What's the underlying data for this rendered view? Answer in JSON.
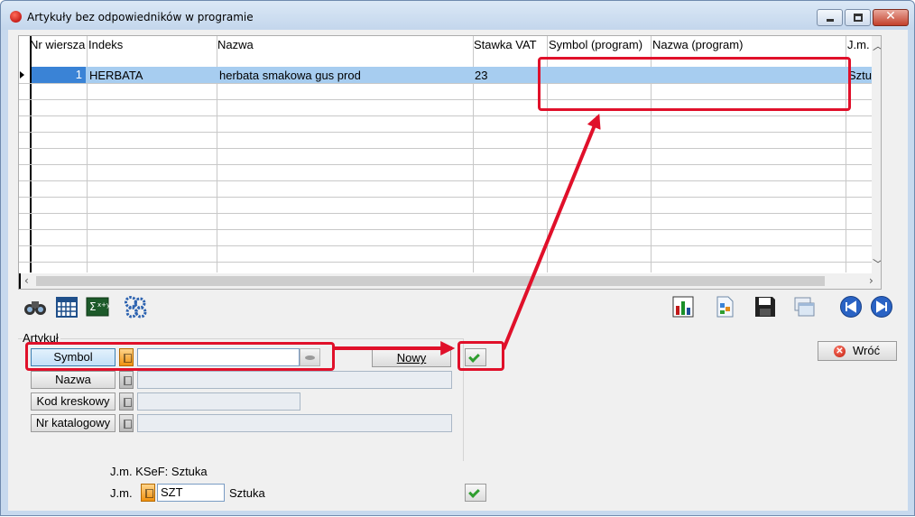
{
  "window": {
    "title": "Artykuły bez odpowiedników w programie"
  },
  "grid": {
    "columns": [
      "Nr wiersza",
      "Indeks",
      "Nazwa",
      "Stawka VAT",
      "Symbol (program)",
      "Nazwa (program)",
      "J.m."
    ],
    "rows": [
      {
        "nr_wiersza": "1",
        "indeks": "HERBATA",
        "nazwa": "herbata smakowa gus prod",
        "stawka_vat": "23",
        "symbol_program": "",
        "nazwa_program": "",
        "jm": "Sztuka"
      }
    ]
  },
  "toolbar": {
    "left_icons": [
      "binoculars-icon",
      "calendar-icon",
      "formula-icon",
      "gears-icon"
    ],
    "right_icons": [
      "chart-icon",
      "document-icon",
      "save-icon",
      "windows-icon",
      "prev-icon",
      "next-icon"
    ]
  },
  "artykul": {
    "group_label": "Artykuł",
    "symbol_label": "Symbol",
    "symbol_value": "",
    "nazwa_label": "Nazwa",
    "nazwa_value": "",
    "kod_kreskowy_label": "Kod kreskowy",
    "kod_kreskowy_value": "",
    "nr_katalogowy_label": "Nr katalogowy",
    "nr_katalogowy_value": "",
    "nowy_label": "Nowy"
  },
  "wroc_label": "Wróć",
  "jm": {
    "ksef_label": "J.m. KSeF: Sztuka",
    "label": "J.m.",
    "value": "SZT",
    "name": "Sztuka"
  },
  "colors": {
    "highlight": "#e0102a",
    "selected_row": "#a7cdf0",
    "selected_cell": "#3a83d6",
    "ok_check": "#2f9e2f"
  }
}
